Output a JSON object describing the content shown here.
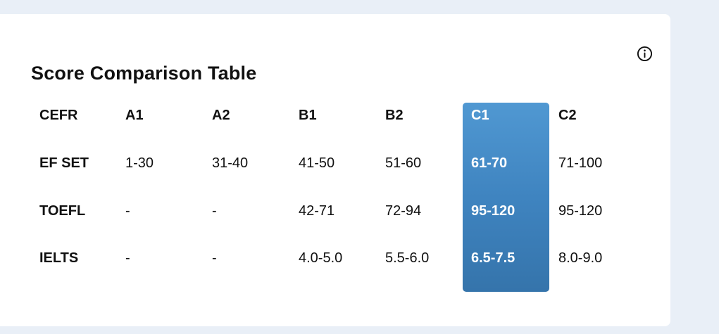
{
  "card": {
    "title": "Score Comparison Table",
    "info_icon": "info-icon"
  },
  "colors": {
    "page_background": "#e9eff7",
    "card_background": "#ffffff",
    "highlight_gradient_top": "#5098d2",
    "highlight_gradient_bottom": "#3574ab",
    "highlight_text": "#ffffff"
  },
  "table": {
    "highlighted_column": "C1",
    "header": {
      "label": "CEFR",
      "levels": [
        "A1",
        "A2",
        "B1",
        "B2",
        "C1",
        "C2"
      ]
    },
    "rows": [
      {
        "label": "EF SET",
        "values": [
          "1-30",
          "31-40",
          "41-50",
          "51-60",
          "61-70",
          "71-100"
        ]
      },
      {
        "label": "TOEFL",
        "values": [
          "-",
          "-",
          "42-71",
          "72-94",
          "95-120",
          "95-120"
        ]
      },
      {
        "label": "IELTS",
        "values": [
          "-",
          "-",
          "4.0-5.0",
          "5.5-6.0",
          "6.5-7.5",
          "8.0-9.0"
        ]
      }
    ]
  }
}
